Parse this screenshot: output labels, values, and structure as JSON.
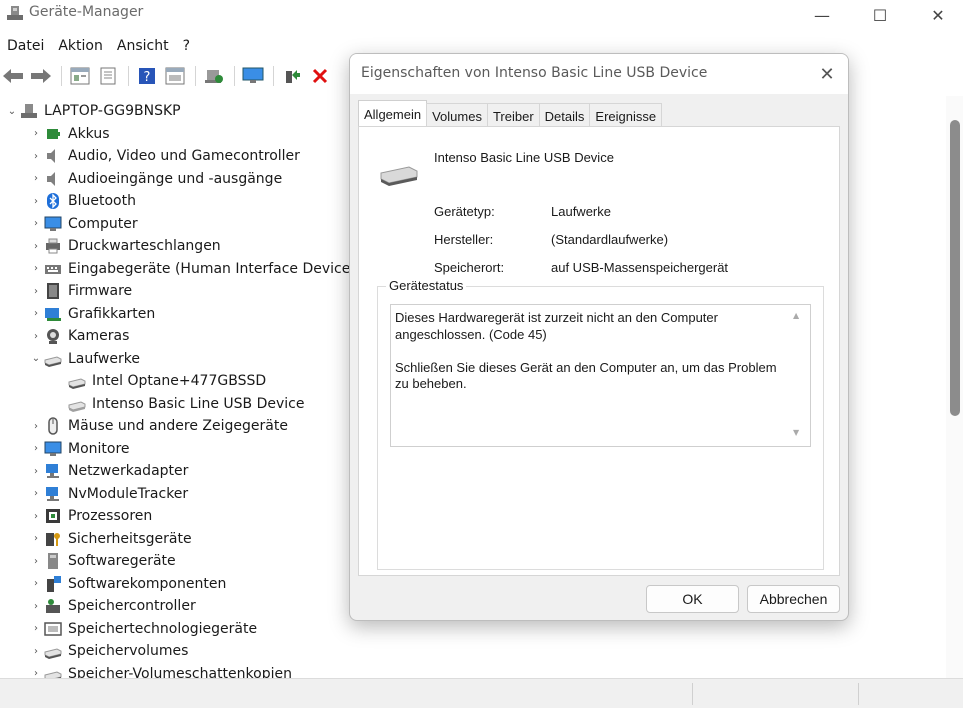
{
  "window": {
    "title": "Geräte-Manager",
    "min_glyph": "—",
    "max_glyph": "☐",
    "close_glyph": "✕"
  },
  "menu": [
    "Datei",
    "Aktion",
    "Ansicht",
    "?"
  ],
  "toolbar": {
    "buttons": [
      "back-arrow-icon",
      "forward-arrow-icon",
      "properties-icon",
      "driver-list-icon",
      "help-icon",
      "view-icon",
      "scan-hardware-icon",
      "monitor-icon",
      "add-driver-icon",
      "uninstall-icon"
    ]
  },
  "tree": {
    "root": "LAPTOP-GG9BNSKP",
    "items": [
      {
        "label": "Akkus",
        "icon": "battery-icon",
        "color": "#2e8b3a"
      },
      {
        "label": "Audio, Video und Gamecontroller",
        "icon": "speaker-icon",
        "color": "#808080"
      },
      {
        "label": "Audioeingänge und -ausgänge",
        "icon": "speaker-icon",
        "color": "#808080"
      },
      {
        "label": "Bluetooth",
        "icon": "bluetooth-icon",
        "color": "#1e6fd9"
      },
      {
        "label": "Computer",
        "icon": "computer-icon",
        "color": "#3a8ee6"
      },
      {
        "label": "Druckwarteschlangen",
        "icon": "printer-icon",
        "color": "#666666"
      },
      {
        "label": "Eingabegeräte (Human Interface Devices)",
        "icon": "keyboard-icon",
        "color": "#777777"
      },
      {
        "label": "Firmware",
        "icon": "firmware-icon",
        "color": "#444444"
      },
      {
        "label": "Grafikkarten",
        "icon": "display-adapter-icon",
        "color": "#2f7fd6"
      },
      {
        "label": "Kameras",
        "icon": "camera-icon",
        "color": "#555555"
      },
      {
        "label": "Laufwerke",
        "icon": "drive-icon",
        "color": "#555555",
        "expanded": true
      },
      {
        "label": "Intel Optane+477GBSSD",
        "icon": "drive-icon",
        "color": "#555555",
        "child": true
      },
      {
        "label": "Intenso Basic Line USB Device",
        "icon": "drive-icon",
        "color": "#a0a0a0",
        "child": true
      },
      {
        "label": "Mäuse und andere Zeigegeräte",
        "icon": "mouse-icon",
        "color": "#555555"
      },
      {
        "label": "Monitore",
        "icon": "monitor-icon",
        "color": "#3a8ee6"
      },
      {
        "label": "Netzwerkadapter",
        "icon": "network-icon",
        "color": "#2f7fd6"
      },
      {
        "label": "NvModuleTracker",
        "icon": "network-icon",
        "color": "#2f7fd6"
      },
      {
        "label": "Prozessoren",
        "icon": "processor-icon",
        "color": "#3a3a3a"
      },
      {
        "label": "Sicherheitsgeräte",
        "icon": "security-key-icon",
        "color": "#d69a12"
      },
      {
        "label": "Softwaregeräte",
        "icon": "software-device-icon",
        "color": "#888888"
      },
      {
        "label": "Softwarekomponenten",
        "icon": "software-component-icon",
        "color": "#2f7fd6"
      },
      {
        "label": "Speichercontroller",
        "icon": "storage-controller-icon",
        "color": "#555555"
      },
      {
        "label": "Speichertechnologiegeräte",
        "icon": "memory-tech-icon",
        "color": "#555555"
      },
      {
        "label": "Speichervolumes",
        "icon": "drive-icon",
        "color": "#555555"
      },
      {
        "label": "Speicher-Volumeschattenkopien",
        "icon": "drive-icon",
        "color": "#555555"
      }
    ]
  },
  "dialog": {
    "title": "Eigenschaften von Intenso Basic Line USB Device",
    "close_glyph": "✕",
    "tabs": [
      "Allgemein",
      "Volumes",
      "Treiber",
      "Details",
      "Ereignisse"
    ],
    "active_tab": "Allgemein",
    "device_name": "Intenso Basic Line USB Device",
    "properties": [
      {
        "label": "Gerätetyp:",
        "value": "Laufwerke"
      },
      {
        "label": "Hersteller:",
        "value": "(Standardlaufwerke)"
      },
      {
        "label": "Speicherort:",
        "value": "auf USB-Massenspeichergerät"
      }
    ],
    "status_group": "Gerätestatus",
    "status_text": "Dieses Hardwaregerät ist zurzeit nicht an den Computer angeschlossen. (Code 45)\n\nSchließen Sie dieses Gerät an den Computer an, um das Problem zu beheben.",
    "ok_label": "OK",
    "cancel_label": "Abbrechen"
  }
}
